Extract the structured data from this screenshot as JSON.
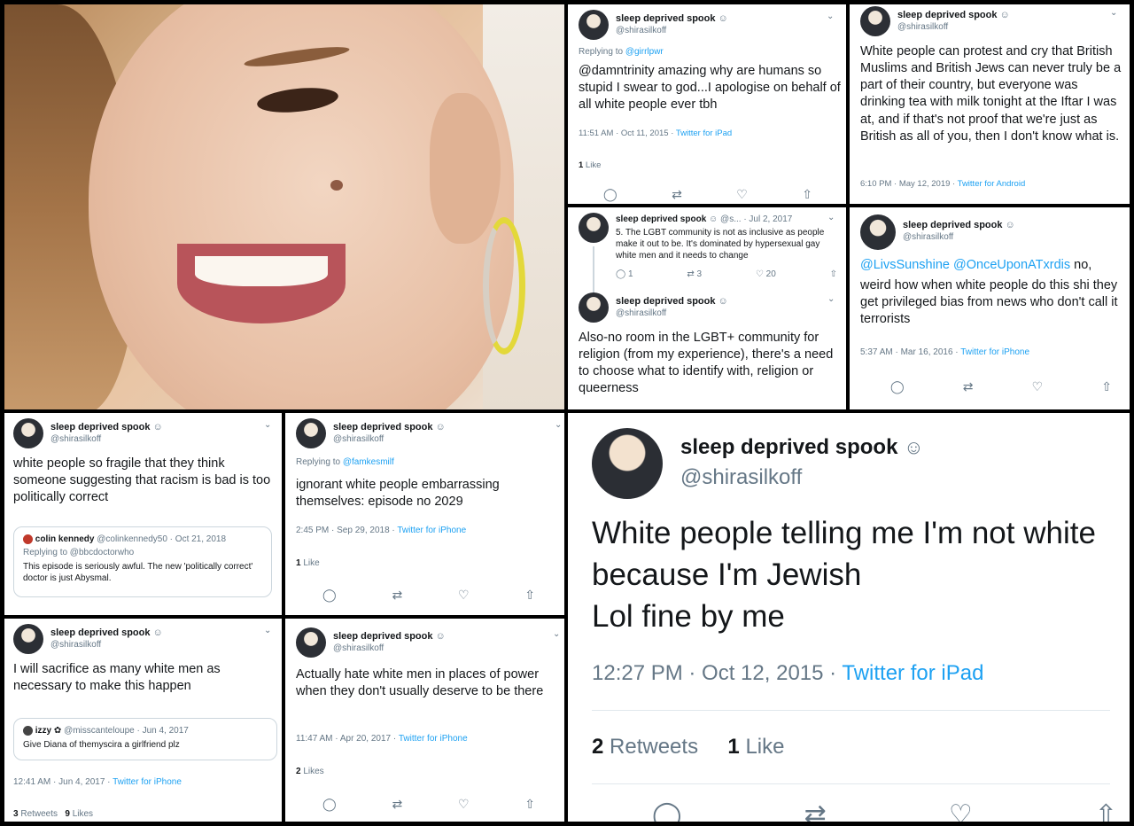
{
  "user": {
    "name": "sleep deprived spook",
    "handle": "@shirasilkoff",
    "badge": "ghost-icon"
  },
  "t1": {
    "reply_label": "Replying to ",
    "reply_to": "@girrlpwr",
    "text": "@damntrinity amazing why are humans so stupid I swear to god...I apologise on behalf of all white people ever tbh",
    "time": "11:51 AM · Oct 11, 2015 · ",
    "source": "Twitter for iPad",
    "likes_n": "1",
    "likes_l": " Like"
  },
  "t2": {
    "text": "White people can protest and cry that British Muslims and British Jews can never truly be a part of their country, but everyone was drinking tea with milk tonight at the Iftar I was at, and if that's not proof that we're just as British as all of you, then I don't know what is.",
    "time": "6:10 PM · May 12, 2019 · ",
    "source": "Twitter for Android"
  },
  "t3": {
    "name_short": "sleep deprived spook",
    "handle_short": "@s...",
    "date": "· Jul 2, 2017",
    "text": "5. The LGBT community is not as inclusive as people make it out to be. It's dominated by hypersexual gay white men and it needs to change",
    "replies": "1",
    "retweets": "3",
    "likes": "20"
  },
  "t4": {
    "text": "Also-no room in the LGBT+ community for religion (from my experience), there's a need to choose what to identify with, religion or queerness"
  },
  "t5": {
    "mention1": "@LivsSunshine",
    "mention2": "@OnceUponATxrdis",
    "text_a": " no,",
    "text_b": "weird how when white people do this shi they get privileged bias from news who don't call it terrorists",
    "time": "5:37 AM · Mar 16, 2016 · ",
    "source": "Twitter for iPhone"
  },
  "t6": {
    "text": "white people so fragile that they think someone suggesting that racism is bad is too politically correct",
    "q_name": "colin kennedy",
    "q_handle": "@colinkennedy50 · Oct 21, 2018",
    "q_reply": "Replying to @bbcdoctorwho",
    "q_text": "This episode is seriously awful. The new 'politically correct' doctor is just Abysmal."
  },
  "t7": {
    "reply_label": "Replying to ",
    "reply_to": "@famkesmilf",
    "text": "ignorant white people embarrassing themselves: episode no 2029",
    "time": "2:45 PM · Sep 29, 2018 · ",
    "source": "Twitter for iPhone",
    "likes_n": "1",
    "likes_l": " Like"
  },
  "t8": {
    "text": "I will sacrifice as many white men as necessary to make this happen",
    "q_name": "izzy",
    "q_handle": "@misscanteloupe · Jun 4, 2017",
    "q_text": "Give Diana of themyscira a girlfriend plz",
    "time": "12:41 AM · Jun 4, 2017 · ",
    "source": "Twitter for iPhone",
    "rt_n": "3",
    "rt_l": " Retweets",
    "likes_n": "9",
    "likes_l": " Likes"
  },
  "t9": {
    "text": "Actually hate white men in places of power when they don't usually deserve to be there",
    "time": "11:47 AM · Apr 20, 2017 · ",
    "source": "Twitter for iPhone",
    "likes_n": "2",
    "likes_l": " Likes"
  },
  "t10": {
    "line1": "White people telling me I'm not white",
    "line2": "because I'm Jewish",
    "line3": "Lol fine by me",
    "time": "12:27 PM · Oct 12, 2015 · ",
    "source": "Twitter for iPad",
    "rt_n": "2",
    "rt_l": " Retweets",
    "likes_n": "1",
    "likes_l": " Like"
  },
  "icons": {
    "reply": "reply-icon",
    "retweet": "retweet-icon",
    "like": "heart-icon",
    "share": "share-icon",
    "chevron": "chevron-down-icon"
  },
  "colors": {
    "link": "#1da1f2",
    "muted": "#657786",
    "text": "#14171a"
  }
}
